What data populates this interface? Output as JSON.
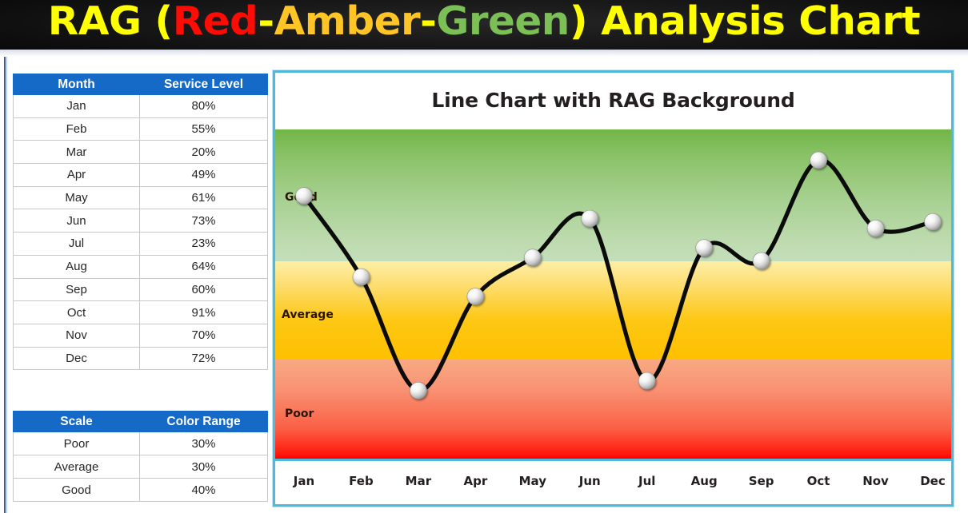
{
  "header": {
    "parts": [
      {
        "text": "RAG (",
        "color": "#ffff00"
      },
      {
        "text": "Red",
        "color": "#ff0b06"
      },
      {
        "text": "-",
        "color": "#ffff00"
      },
      {
        "text": "Amber",
        "color": "#ffc425"
      },
      {
        "text": "-",
        "color": "#ffff00"
      },
      {
        "text": "Green",
        "color": "#7cbf56"
      },
      {
        "text": ") Analysis Chart",
        "color": "#ffff00"
      }
    ],
    "full_title": "RAG (Red-Amber-Green) Analysis Chart",
    "background": "#000000"
  },
  "month_table": {
    "headers": [
      "Month",
      "Service Level"
    ],
    "header_bg": "#1569c7",
    "header_color": "#ffffff",
    "rows": [
      [
        "Jan",
        "80%"
      ],
      [
        "Feb",
        "55%"
      ],
      [
        "Mar",
        "20%"
      ],
      [
        "Apr",
        "49%"
      ],
      [
        "May",
        "61%"
      ],
      [
        "Jun",
        "73%"
      ],
      [
        "Jul",
        "23%"
      ],
      [
        "Aug",
        "64%"
      ],
      [
        "Sep",
        "60%"
      ],
      [
        "Oct",
        "91%"
      ],
      [
        "Nov",
        "70%"
      ],
      [
        "Dec",
        "72%"
      ]
    ]
  },
  "scale_table": {
    "headers": [
      "Scale",
      "Color Range"
    ],
    "header_bg": "#1569c7",
    "rows": [
      [
        "Poor",
        "30%"
      ],
      [
        "Average",
        "30%"
      ],
      [
        "Good",
        "40%"
      ]
    ]
  },
  "chart": {
    "title": "Line Chart with RAG Background",
    "border_color": "#4fb9dd",
    "band_labels": {
      "good": "Good",
      "average": "Average",
      "poor": "Poor"
    }
  },
  "chart_data": {
    "type": "line",
    "title": "Line Chart with RAG Background",
    "xlabel": "",
    "ylabel": "",
    "ylim": [
      0,
      100
    ],
    "grid": false,
    "legend": "none",
    "categories": [
      "Jan",
      "Feb",
      "Mar",
      "Apr",
      "May",
      "Jun",
      "Jul",
      "Aug",
      "Sep",
      "Oct",
      "Nov",
      "Dec"
    ],
    "series": [
      {
        "name": "Service Level",
        "values": [
          80,
          55,
          20,
          49,
          61,
          73,
          23,
          64,
          60,
          91,
          70,
          72
        ],
        "line_color": "#000000",
        "marker": "sphere-white"
      }
    ],
    "bands": [
      {
        "label": "Poor",
        "range": [
          0,
          30
        ],
        "size": 30,
        "color_top": "#f7a983",
        "color_bottom": "#fe0000"
      },
      {
        "label": "Average",
        "range": [
          30,
          60
        ],
        "size": 30,
        "color_top": "#fdefa6",
        "color_bottom": "#ffc000"
      },
      {
        "label": "Good",
        "range": [
          60,
          100
        ],
        "size": 40,
        "color_top": "#71b648",
        "color_bottom": "#c3debb"
      }
    ]
  }
}
